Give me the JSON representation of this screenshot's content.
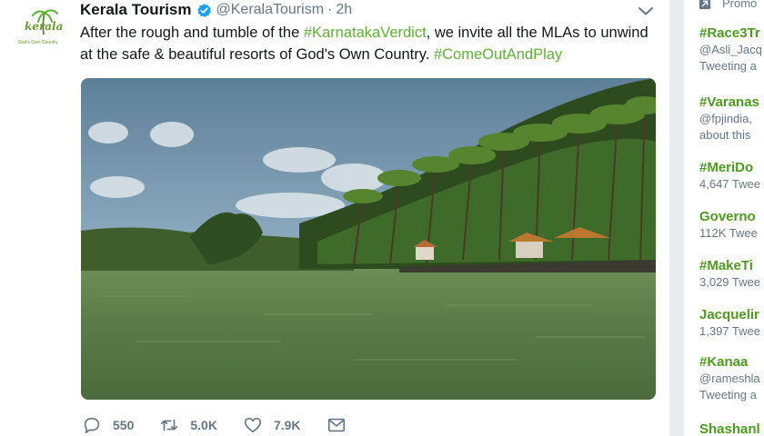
{
  "tweet": {
    "author": {
      "name": "Kerala Tourism",
      "handle": "@KeralaTourism",
      "logo_text": "kerala",
      "logo_tagline": "God's Own Country"
    },
    "separator": "·",
    "time": "2h",
    "text_parts": [
      {
        "text": "After the rough and tumble of the ",
        "highlight": false
      },
      {
        "text": "#KarnatakaVerdict",
        "highlight": true
      },
      {
        "text": ", we invite all the MLAs to unwind at the safe & beautiful resorts of God's Own Country. ",
        "highlight": false
      },
      {
        "text": "#ComeOutAndPlay",
        "highlight": true
      }
    ],
    "actions": {
      "replies": "550",
      "retweets": "5.0K",
      "likes": "7.9K"
    }
  },
  "sidebar": {
    "promo_label": "Promo",
    "trends": [
      {
        "name": "#Race3Tr",
        "meta": [
          "@Asli_Jacq",
          "Tweeting a"
        ]
      },
      {
        "name": "#Varanas",
        "meta": [
          "@fpjindia,",
          "about this"
        ]
      },
      {
        "name": "#MeriDo",
        "meta": [
          "4,647 Twee"
        ]
      },
      {
        "name": "Governo",
        "meta": [
          "112K Twee"
        ]
      },
      {
        "name": "#MakeTi",
        "meta": [
          "3,029 Twee"
        ]
      },
      {
        "name": "Jacquelir",
        "meta": [
          "1,397 Twee"
        ]
      },
      {
        "name": "#Kanaa",
        "meta": [
          "@rameshla",
          "Tweeting a"
        ]
      },
      {
        "name": "Shashanl",
        "meta": []
      }
    ]
  },
  "colors": {
    "hashtag": "#5eb232",
    "trend": "#4d9b1d",
    "muted": "#657786",
    "verified": "#1da1f2"
  }
}
